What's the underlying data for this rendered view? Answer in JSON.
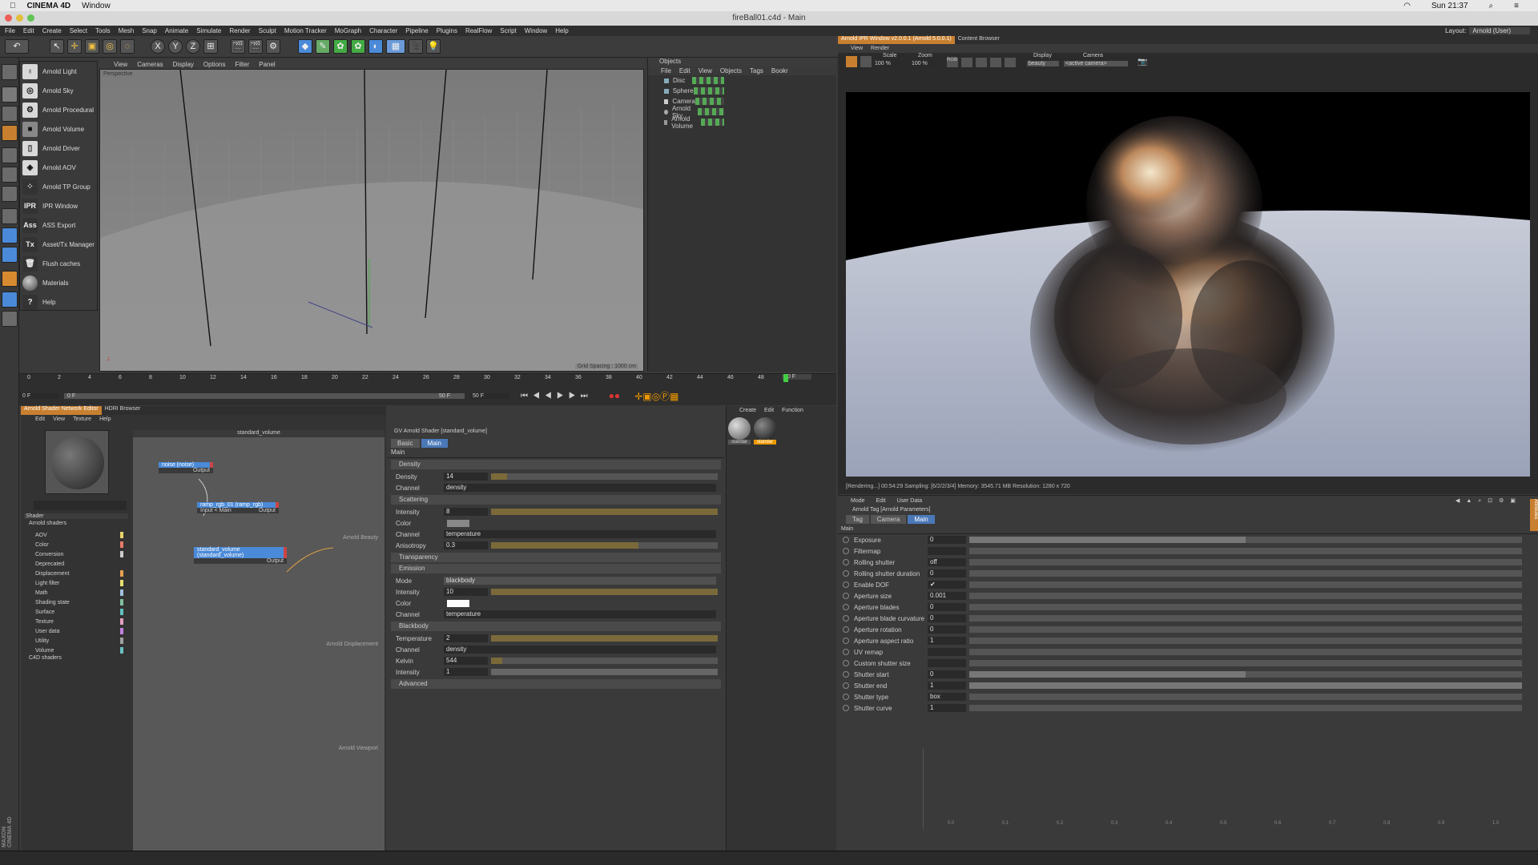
{
  "mac": {
    "app": "CINEMA 4D",
    "window_menu": "Window",
    "clock": "Sun 21:37"
  },
  "title": "fireBall01.c4d - Main",
  "menu": [
    "File",
    "Edit",
    "Create",
    "Select",
    "Tools",
    "Mesh",
    "Snap",
    "Animate",
    "Simulate",
    "Render",
    "Sculpt",
    "Motion Tracker",
    "MoGraph",
    "Character",
    "Pipeline",
    "Plugins",
    "RealFlow",
    "Script",
    "Window",
    "Help"
  ],
  "layout": {
    "label": "Layout:",
    "value": "Arnold (User)"
  },
  "toolbar": {
    "x": "X",
    "y": "Y",
    "z": "Z"
  },
  "arnold_menu": [
    {
      "icon": "light",
      "label": "Arnold Light"
    },
    {
      "icon": "sky",
      "label": "Arnold Sky"
    },
    {
      "icon": "procedural",
      "label": "Arnold Procedural"
    },
    {
      "icon": "volume",
      "label": "Arnold Volume"
    },
    {
      "icon": "driver",
      "label": "Arnold Driver"
    },
    {
      "icon": "aov",
      "label": "Arnold AOV"
    },
    {
      "icon": "tp",
      "label": "Arnold TP Group"
    },
    {
      "icon": "IPR",
      "label": "IPR Window"
    },
    {
      "icon": "Ass",
      "label": "ASS Export"
    },
    {
      "icon": "Tx",
      "label": "Asset/Tx Manager"
    },
    {
      "icon": "trash",
      "label": "Flush caches"
    },
    {
      "icon": "sphere",
      "label": "Materials"
    },
    {
      "icon": "?",
      "label": "Help"
    }
  ],
  "viewport": {
    "menu": [
      "View",
      "Cameras",
      "Display",
      "Options",
      "Filter",
      "Panel"
    ],
    "name": "Perspective",
    "grid": "Grid Spacing : 1000 cm"
  },
  "objects": {
    "title": "Objects",
    "menu": [
      "File",
      "Edit",
      "View",
      "Objects",
      "Tags",
      "Bookr"
    ],
    "items": [
      "Disc",
      "Sphere",
      "Camera",
      "Arnold Sky",
      "Arnold Volume"
    ]
  },
  "timeline": {
    "ticks": [
      "0",
      "2",
      "4",
      "6",
      "8",
      "10",
      "12",
      "14",
      "16",
      "18",
      "20",
      "22",
      "24",
      "26",
      "28",
      "30",
      "32",
      "34",
      "36",
      "38",
      "40",
      "42",
      "44",
      "46",
      "48"
    ],
    "current": "50 F",
    "start": "0 F",
    "min": "0 F",
    "max": "50 F",
    "end": "50 F"
  },
  "shader_editor": {
    "tabs": [
      "Arnold Shader Network Editor",
      "HDRI Browser"
    ],
    "menu": [
      "Edit",
      "View",
      "Texture",
      "Help"
    ],
    "canvas_title": "standard_volume",
    "shader_head": "Shader",
    "tree_root": "Arnold shaders",
    "tree": [
      "AOV",
      "Color",
      "Conversion",
      "Deprecated",
      "Displacement",
      "Light filter",
      "Math",
      "Shading state",
      "Surface",
      "Texture",
      "User data",
      "Utility",
      "Volume"
    ],
    "tree_colors": [
      "#e8d36a",
      "#e87a6a",
      "#ccc",
      "#333",
      "#e8a050",
      "#e8e070",
      "#a0c0e0",
      "#80c0a0",
      "#60c0c0",
      "#e0a0c0",
      "#c080e0",
      "#a0a0a0",
      "#6ac0c0"
    ],
    "tree_c4d": "C4D shaders",
    "nodes": {
      "noise": {
        "title": "noise (noise)",
        "out": "Output"
      },
      "ramp": {
        "title": "ramp_rgb_01 (ramp_rgb)",
        "in": "Input < Main",
        "out": "Output"
      },
      "volume": {
        "title": "standard_volume (standard_volume)",
        "out": "Output"
      }
    },
    "ports": [
      "Arnold Beauty",
      "Arnold Displacement",
      "Arnold Viewport"
    ]
  },
  "attr": {
    "title": "GV Arnold Shader [standard_volume]",
    "tabs": [
      "Basic",
      "Main"
    ],
    "section_main": "Main",
    "density": {
      "head": "Density",
      "density_label": "Density",
      "density_value": "14",
      "density_level": 0.07,
      "channel_label": "Channel",
      "channel_value": "density"
    },
    "scattering": {
      "head": "Scattering",
      "intensity_label": "Intensity",
      "intensity_value": "8",
      "intensity_level": 1.0,
      "color_label": "Color",
      "channel_label": "Channel",
      "channel_value": "temperature",
      "aniso_label": "Anisotropy",
      "aniso_value": "0.3",
      "aniso_level": 0.65
    },
    "transparency": "Transparency",
    "emission": {
      "head": "Emission",
      "mode_label": "Mode",
      "mode_value": "blackbody",
      "intensity_label": "Intensity",
      "intensity_value": "10",
      "intensity_level": 1.0,
      "color_label": "Color",
      "channel_label": "Channel",
      "channel_value": "temperature"
    },
    "blackbody": {
      "head": "Blackbody",
      "temp_label": "Temperature",
      "temp_value": "2",
      "temp_level": 1.0,
      "channel_label": "Channel",
      "channel_value": "density",
      "kelvin_label": "Kelvin",
      "kelvin_value": "544",
      "kelvin_level": 0.05,
      "intensity_label": "Intensity",
      "intensity_value": "1",
      "intensity_level": 1.0
    },
    "advanced": "Advanced"
  },
  "materials": {
    "menu": [
      "Create",
      "Edit",
      "Function"
    ],
    "mat1": "standar",
    "mat2": "standar"
  },
  "ipr": {
    "tabs": [
      "Arnold IPR Window v2.0.0.1 (Arnold 5.0.0.1)",
      "Content Browser"
    ],
    "menu": [
      "View",
      "Render"
    ],
    "scale_label": "Scale",
    "scale": "100 %",
    "zoom_label": "Zoom",
    "zoom": "100 %",
    "display_label": "Display",
    "display": "beauty",
    "camera_label": "Camera",
    "camera": "<active camera>",
    "rgb": "RGB",
    "status": "[Rendering...] 00:54:29  Sampling: [6/2/2/3/4]  Memory: 3545.71 MB  Resolution: 1280 x 720"
  },
  "tag": {
    "menu": [
      "Mode",
      "Edit",
      "User Data"
    ],
    "title": "Arnold Tag [Arnold Parameters]",
    "tabs": [
      "Tag",
      "Camera",
      "Main"
    ],
    "section": "Main",
    "rows": [
      {
        "label": "Exposure",
        "value": "0",
        "level": 0.5
      },
      {
        "label": "Filtermap",
        "value": "",
        "level": 0
      },
      {
        "label": "Rolling shutter",
        "value": "off",
        "level": 0
      },
      {
        "label": "Rolling shutter duration",
        "value": "0",
        "level": 0
      },
      {
        "label": "Enable DOF",
        "value": "✔",
        "level": 0
      },
      {
        "label": "Aperture size",
        "value": "0.001",
        "level": 0
      },
      {
        "label": "Aperture blades",
        "value": "0",
        "level": 0
      },
      {
        "label": "Aperture blade curvature",
        "value": "0",
        "level": 0
      },
      {
        "label": "Aperture rotation",
        "value": "0",
        "level": 0
      },
      {
        "label": "Aperture aspect ratio",
        "value": "1",
        "level": 0
      },
      {
        "label": "UV remap",
        "value": "",
        "level": 0
      },
      {
        "label": "Custom shutter size",
        "value": "",
        "level": 0
      },
      {
        "label": "Shutter start",
        "value": "0",
        "level": 0.5
      },
      {
        "label": "Shutter end",
        "value": "1",
        "level": 1.0
      },
      {
        "label": "Shutter type",
        "value": "box",
        "level": 0
      },
      {
        "label": "Shutter curve",
        "value": "1",
        "level": 0
      }
    ],
    "curve_ticks": [
      "0.0",
      "0.1",
      "0.2",
      "0.3",
      "0.4",
      "0.5",
      "0.6",
      "0.7",
      "0.8",
      "0.9",
      "1.0"
    ]
  },
  "brand": "MAXON CINEMA 4D",
  "attributes_tab": "Attributes"
}
